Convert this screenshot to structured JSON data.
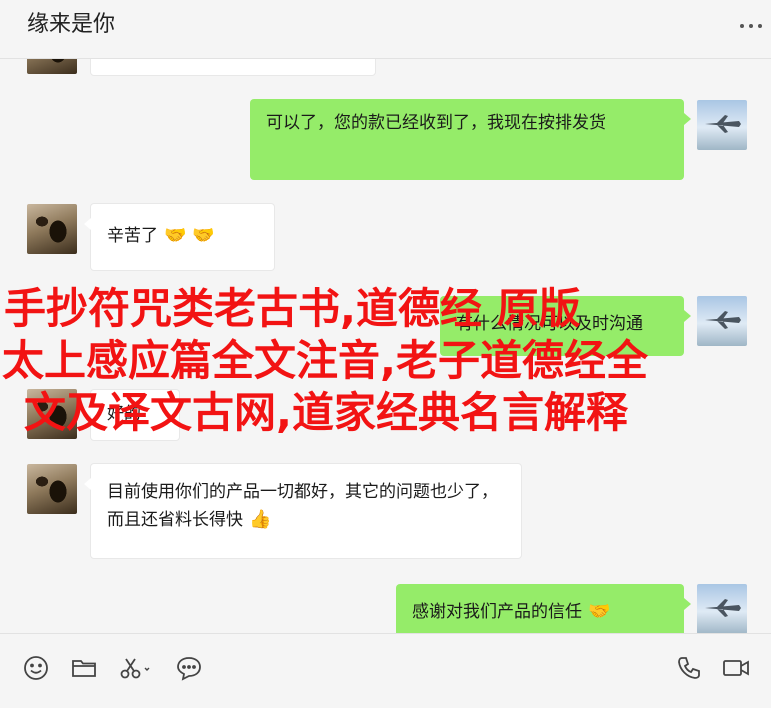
{
  "header": {
    "title": "缘来是你"
  },
  "messages": [
    {
      "side": "right",
      "text": "可以了，您的款已经收到了，我现在按排发货"
    },
    {
      "side": "left",
      "text": "辛苦了",
      "emoji": "🤝 🤝"
    },
    {
      "side": "right",
      "text": "有什么情况可以及时沟通"
    },
    {
      "side": "left",
      "text": "好的"
    },
    {
      "side": "left",
      "text": "目前使用你们的产品一切都好，其它的问题也少了，而且还省料长得快",
      "emoji": "👍"
    },
    {
      "side": "right",
      "text": "感谢对我们产品的信任",
      "emoji": "🤝"
    }
  ],
  "overlay": {
    "line1": "手抄符咒类老古书,道德经 原版",
    "line2": "太上感应篇全文注音,老子道德经全",
    "line3": "文及译文古网,道家经典名言解释",
    "color": "#f21313"
  },
  "colors": {
    "bubble_self": "#95ec69",
    "bubble_other": "#ffffff",
    "background": "#f5f5f5"
  },
  "toolbar": {
    "left_icons": [
      "emoji-icon",
      "folder-icon",
      "scissors-icon",
      "chat-history-icon"
    ],
    "right_icons": [
      "phone-icon",
      "video-icon"
    ]
  }
}
